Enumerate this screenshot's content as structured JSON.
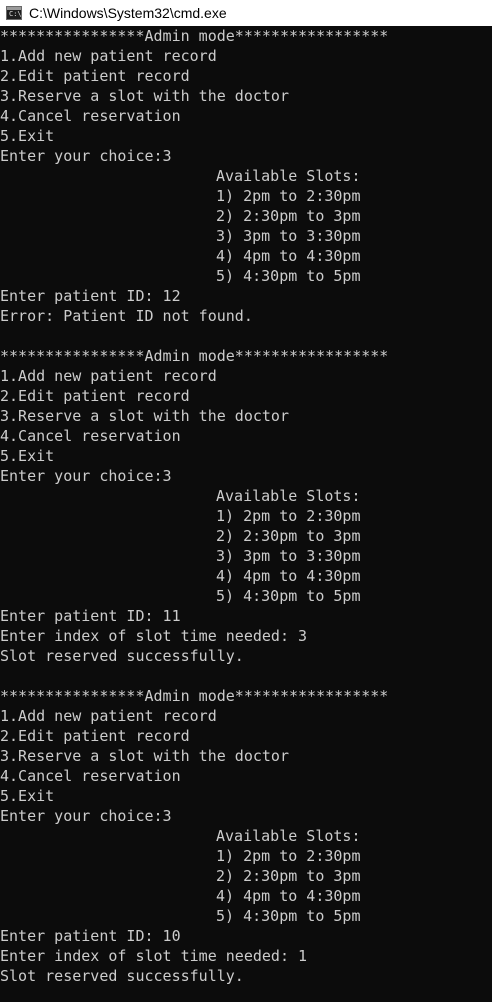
{
  "window": {
    "title": "C:\\Windows\\System32\\cmd.exe",
    "icon": "cmd-console-icon",
    "icon_glyph": "C:\\"
  },
  "colors": {
    "console_background": "#0c0c0c",
    "console_text": "#cccccc",
    "titlebar_background": "#ffffff"
  },
  "console": {
    "lines": [
      "****************Admin mode*****************",
      "1.Add new patient record",
      "2.Edit patient record",
      "3.Reserve a slot with the doctor",
      "4.Cancel reservation",
      "5.Exit",
      "Enter your choice:3",
      "Available Slots:",
      "1) 2pm to 2:30pm",
      "2) 2:30pm to 3pm",
      "3) 3pm to 3:30pm",
      "4) 4pm to 4:30pm",
      "5) 4:30pm to 5pm",
      "Enter patient ID: 12",
      "Error: Patient ID not found.",
      "",
      "****************Admin mode*****************",
      "1.Add new patient record",
      "2.Edit patient record",
      "3.Reserve a slot with the doctor",
      "4.Cancel reservation",
      "5.Exit",
      "Enter your choice:3",
      "Available Slots:",
      "1) 2pm to 2:30pm",
      "2) 2:30pm to 3pm",
      "3) 3pm to 3:30pm",
      "4) 4pm to 4:30pm",
      "5) 4:30pm to 5pm",
      "Enter patient ID: 11",
      "Enter index of slot time needed: 3",
      "Slot reserved successfully.",
      "",
      "****************Admin mode*****************",
      "1.Add new patient record",
      "2.Edit patient record",
      "3.Reserve a slot with the doctor",
      "4.Cancel reservation",
      "5.Exit",
      "Enter your choice:3",
      "Available Slots:",
      "1) 2pm to 2:30pm",
      "2) 2:30pm to 3pm",
      "4) 4pm to 4:30pm",
      "5) 4:30pm to 5pm",
      "Enter patient ID: 10",
      "Enter index of slot time needed: 1",
      "Slot reserved successfully."
    ]
  }
}
